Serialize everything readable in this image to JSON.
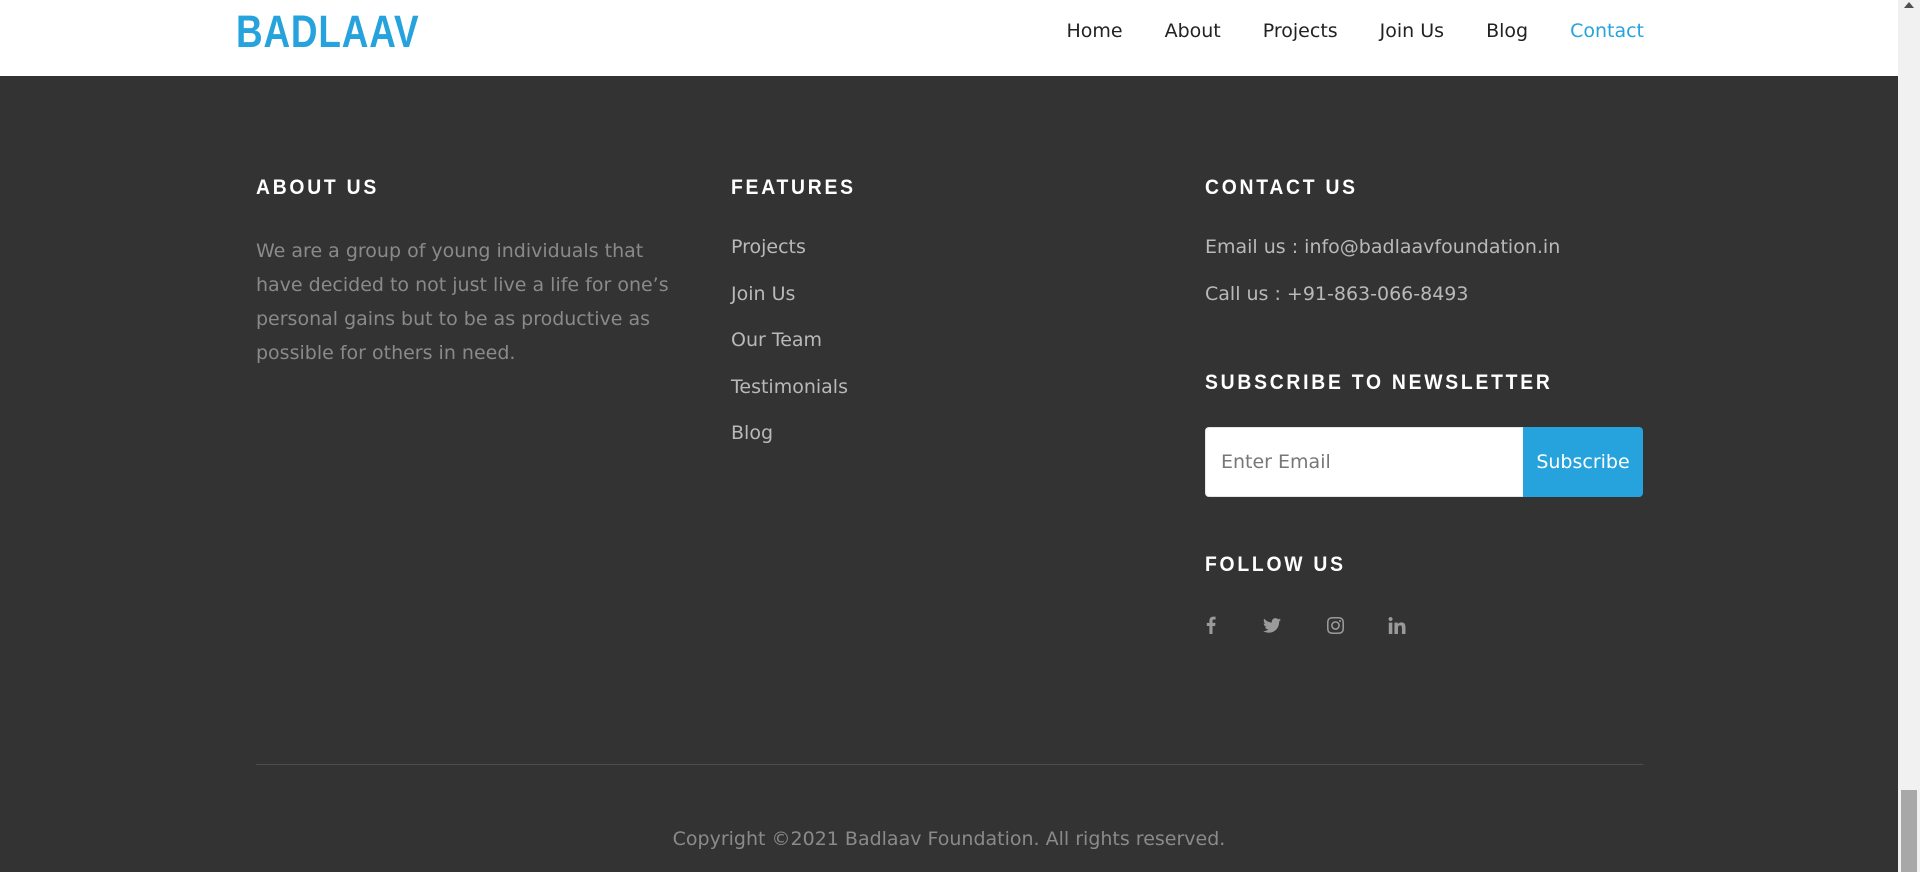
{
  "header": {
    "logo": "BADLAAV",
    "nav": [
      "Home",
      "About",
      "Projects",
      "Join Us",
      "Blog",
      "Contact"
    ],
    "active_nav": "Contact"
  },
  "about": {
    "title": "ABOUT US",
    "text": "We are a group of young individuals that have decided to not just live a life for one’s personal gains but to be as productive as possible for others in need."
  },
  "features": {
    "title": "FEATURES",
    "links": [
      "Projects",
      "Join Us",
      "Our Team",
      "Testimonials",
      "Blog"
    ]
  },
  "contact": {
    "title": "CONTACT US",
    "email": "Email us : info@badlaavfoundation.in",
    "phone": "Call us : +91-863-066-8493"
  },
  "newsletter": {
    "title": "SUBSCRIBE TO NEWSLETTER",
    "placeholder": "Enter Email",
    "button": "Subscribe"
  },
  "follow": {
    "title": "FOLLOW US",
    "icons": [
      "facebook-icon",
      "twitter-icon",
      "instagram-icon",
      "linkedin-icon"
    ]
  },
  "copyright": "Copyright ©2021 Badlaav Foundation. All rights reserved.",
  "colors": {
    "accent": "#26a3dd",
    "footer_bg": "#333333",
    "header_bg": "#ffffff"
  }
}
